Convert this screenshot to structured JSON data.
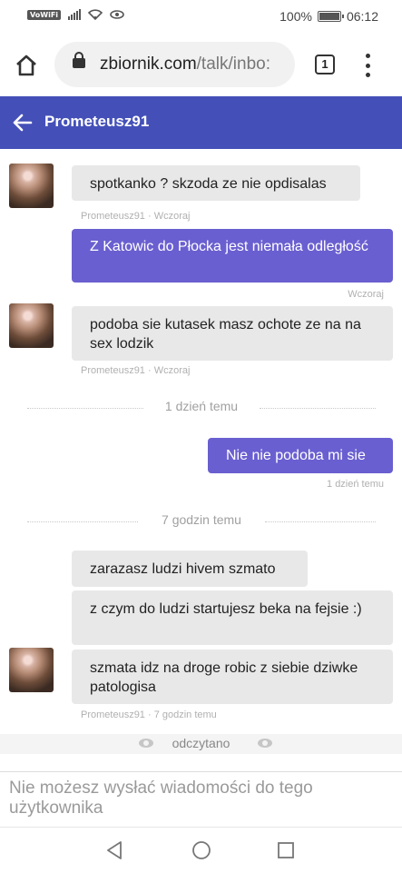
{
  "status_bar": {
    "carrier_badge": "VoWiFi",
    "battery": "100%",
    "battery_level": 1.0,
    "time": "06:12"
  },
  "browser": {
    "url_host": "zbiornik.com",
    "url_path": "/talk/inbo:",
    "tab_count": "1"
  },
  "header": {
    "title": "Prometeusz91"
  },
  "messages": [
    {
      "dir": "in",
      "text": "spotkanko ? skzoda ze nie opdisalas",
      "meta": "Prometeusz91 · Wczoraj"
    },
    {
      "dir": "out",
      "text": "Z Katowic do Płocka jest niemała odległość",
      "meta": "Wczoraj"
    },
    {
      "dir": "in",
      "text": "podoba sie kutasek masz ochote ze na na sex lodzik",
      "meta": "Prometeusz91 · Wczoraj"
    },
    {
      "dir": "out",
      "text": "Nie nie podoba mi sie",
      "meta": "1 dzień temu"
    },
    {
      "dir": "in",
      "text": "zarazasz ludzi hivem szmato"
    },
    {
      "dir": "in",
      "text": "z czym do ludzi startujesz beka na fejsie :)"
    },
    {
      "dir": "in",
      "text": "szmata idz na droge robic z siebie dziwke patologisa",
      "meta": "Prometeusz91 · 7 godzin temu"
    }
  ],
  "separators": [
    "1 dzień temu",
    "7 godzin temu"
  ],
  "read_status": "odczytano",
  "composer_notice": "Nie możesz wysłać wiadomości do tego użytkownika",
  "colors": {
    "header": "#4450b8",
    "outgoing_bubble": "#6a5fd0",
    "incoming_bubble": "#e8e8e8"
  }
}
